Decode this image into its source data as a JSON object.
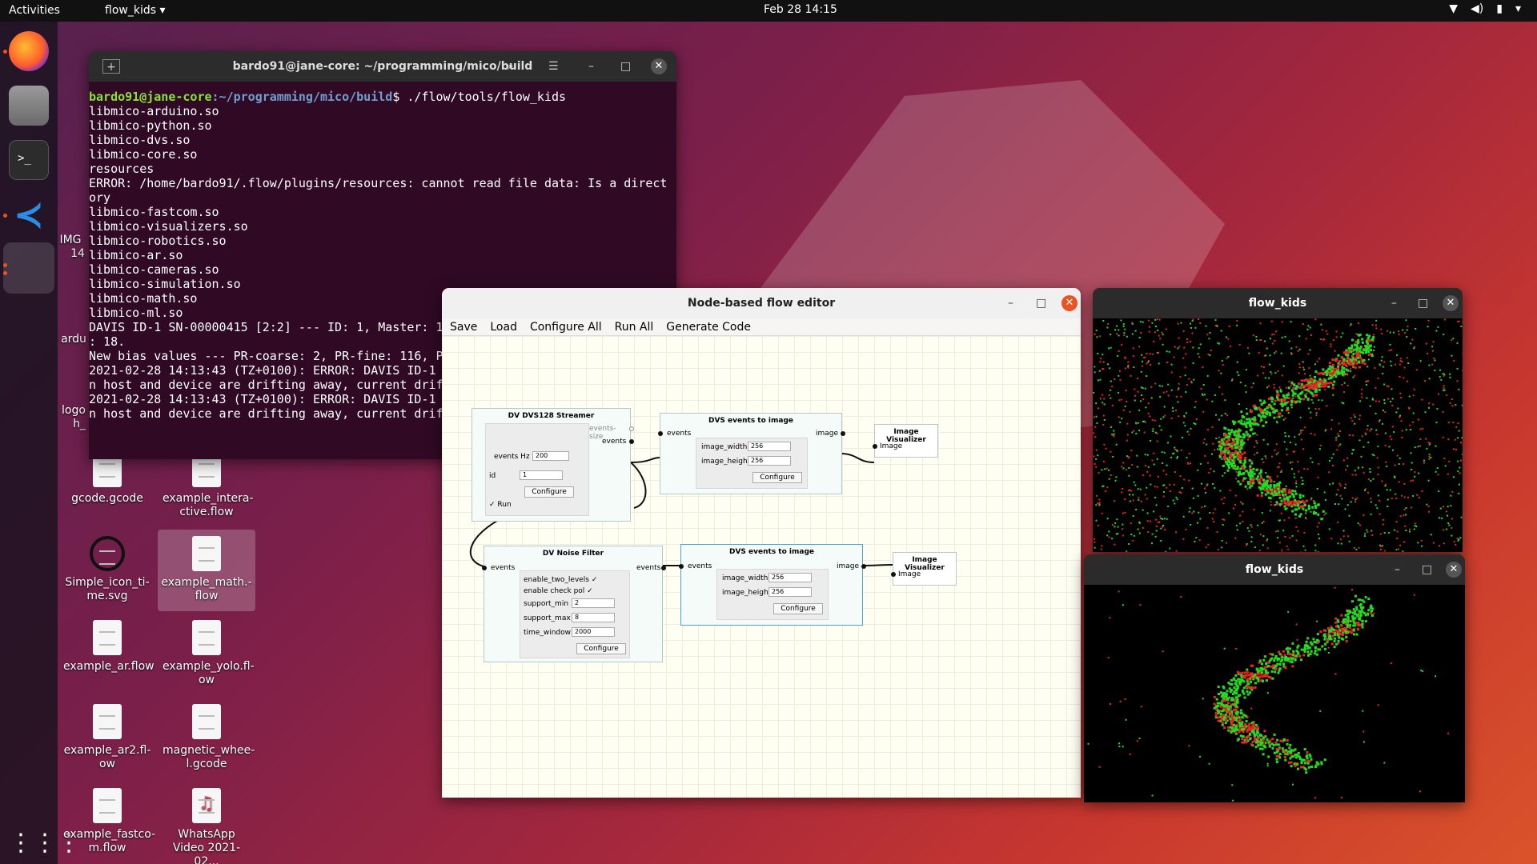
{
  "topbar": {
    "activities": "Activities",
    "app_menu": "flow_kids ▾",
    "clock": "Feb 28  14:15",
    "tray": [
      "wifi-icon",
      "volume-icon",
      "battery-icon",
      "power-menu-icon"
    ]
  },
  "desktop": {
    "items": [
      {
        "label": "gcode.gcode",
        "icon": "file-icon"
      },
      {
        "label": "example_intera-ctive.flow",
        "icon": "file-icon"
      },
      {
        "label": "Simple_icon_ti-me.svg",
        "icon": "clock-icon"
      },
      {
        "label": "example_math.-flow",
        "icon": "file-icon",
        "selected": true
      },
      {
        "label": "example_ar.flow",
        "icon": "file-icon"
      },
      {
        "label": "example_yolo.fl-ow",
        "icon": "file-icon"
      },
      {
        "label": "example_ar2.fl-ow",
        "icon": "file-icon"
      },
      {
        "label": "magnetic_whee-l.gcode",
        "icon": "file-icon"
      },
      {
        "label": "example_fastco-m.flow",
        "icon": "file-icon"
      },
      {
        "label": "WhatsApp Video 2021-02...",
        "icon": "audio-file-icon"
      }
    ],
    "partial": [
      "IMG",
      "14",
      "ardu",
      "logo",
      "h_"
    ]
  },
  "terminal": {
    "title": "bardo91@jane-core: ~/programming/mico/build",
    "prompt_user": "bardo91@jane-core",
    "prompt_path": ":~/programming/mico/build",
    "command": "$ ./flow/tools/flow_kids",
    "lines": [
      "libmico-arduino.so",
      "libmico-python.so",
      "libmico-dvs.so",
      "libmico-core.so",
      "resources",
      "ERROR: /home/bardo91/.flow/plugins/resources: cannot read file data: Is a direct",
      "ory",
      "libmico-fastcom.so",
      "libmico-visualizers.so",
      "libmico-robotics.so",
      "libmico-ar.so",
      "libmico-cameras.so",
      "libmico-simulation.so",
      "libmico-math.so",
      "libmico-ml.so",
      "DAVIS ID-1 SN-00000415 [2:2] --- ID: 1, Master: 1",
      ": 18.",
      "New bias values --- PR-coarse: 2, PR-fine: 116, P",
      "2021-02-28 14:13:43 (TZ+0100): ERROR: DAVIS ID-1",
      "n host and device are drifting away, current drif",
      "2021-02-28 14:13:43 (TZ+0100): ERROR: DAVIS ID-1",
      "n host and device are drifting away, current drif"
    ]
  },
  "editor": {
    "title": "Node-based flow editor",
    "menu": [
      "Save",
      "Load",
      "Configure All",
      "Run All",
      "Generate Code"
    ],
    "nodes": {
      "streamer": {
        "title": "DV DVS128 Streamer",
        "events_hz_label": "events Hz",
        "events_hz": "200",
        "id_label": "id",
        "id": "1",
        "configure": "Configure",
        "run": "✓ Run",
        "out1": "events-size",
        "out2": "events"
      },
      "dvs1": {
        "title": "DVS events to image",
        "in": "events",
        "out": "image",
        "w_label": "image_width",
        "w": "256",
        "h_label": "image_height",
        "h": "256",
        "configure": "Configure"
      },
      "viz1": {
        "title": "Image Visualizer",
        "in": "Image"
      },
      "noise": {
        "title": "DV Noise Filter",
        "in": "events",
        "out": "events",
        "p1": "enable_two_levels ✓",
        "p2": "enable  check  pol  ✓",
        "smin_label": "support_min",
        "smin": "2",
        "smax_label": "support_max",
        "smax": "8",
        "tw_label": "time_window",
        "tw": "2000",
        "configure": "Configure"
      },
      "dvs2": {
        "title": "DVS events to image",
        "in": "events",
        "out": "image",
        "w_label": "image_width",
        "w": "256",
        "h_label": "image_height",
        "h": "256",
        "configure": "Configure"
      },
      "viz2": {
        "title": "Image Visualizer",
        "in": "Image"
      }
    }
  },
  "viewer1": {
    "title": "flow_kids"
  },
  "viewer2": {
    "title": "flow_kids"
  },
  "colors": {
    "accent": "#e95420",
    "close": "#e95420",
    "event_on": "#22dd22",
    "event_off": "#ee2222"
  }
}
